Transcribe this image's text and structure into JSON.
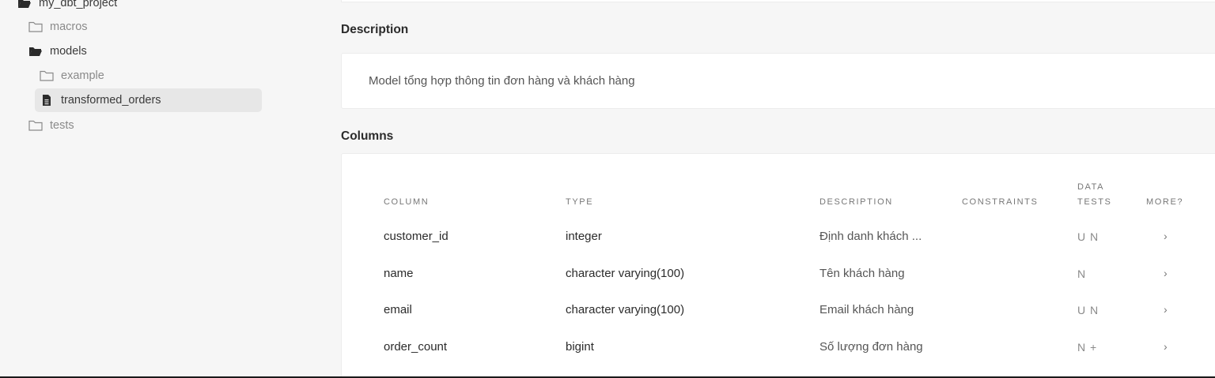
{
  "tree": {
    "root": "my_dbt_project",
    "items": [
      {
        "label": "macros",
        "icon": "folder-icon"
      },
      {
        "label": "models",
        "icon": "folder-open-icon"
      },
      {
        "label": "example",
        "icon": "folder-icon"
      },
      {
        "label": "transformed_orders",
        "icon": "file-icon"
      },
      {
        "label": "tests",
        "icon": "folder-icon"
      }
    ]
  },
  "description": {
    "title": "Description",
    "text": "Model tổng hợp thông tin đơn hàng và khách hàng"
  },
  "columns": {
    "title": "Columns",
    "headers": {
      "column": "COLUMN",
      "type": "TYPE",
      "description": "DESCRIPTION",
      "constraints": "CONSTRAINTS",
      "data_tests_1": "DATA",
      "data_tests_2": "TESTS",
      "more": "MORE?"
    },
    "rows": [
      {
        "column": "customer_id",
        "type": "integer",
        "description": "Định danh khách ...",
        "constraints": "",
        "tests": "U N",
        "more": "›"
      },
      {
        "column": "name",
        "type": "character varying(100)",
        "description": "Tên khách hàng",
        "constraints": "",
        "tests": "N",
        "more": "›"
      },
      {
        "column": "email",
        "type": "character varying(100)",
        "description": "Email khách hàng",
        "constraints": "",
        "tests": "U N",
        "more": "›"
      },
      {
        "column": "order_count",
        "type": "bigint",
        "description": "Số lượng đơn hàng",
        "constraints": "",
        "tests": "N +",
        "more": "›"
      }
    ]
  }
}
